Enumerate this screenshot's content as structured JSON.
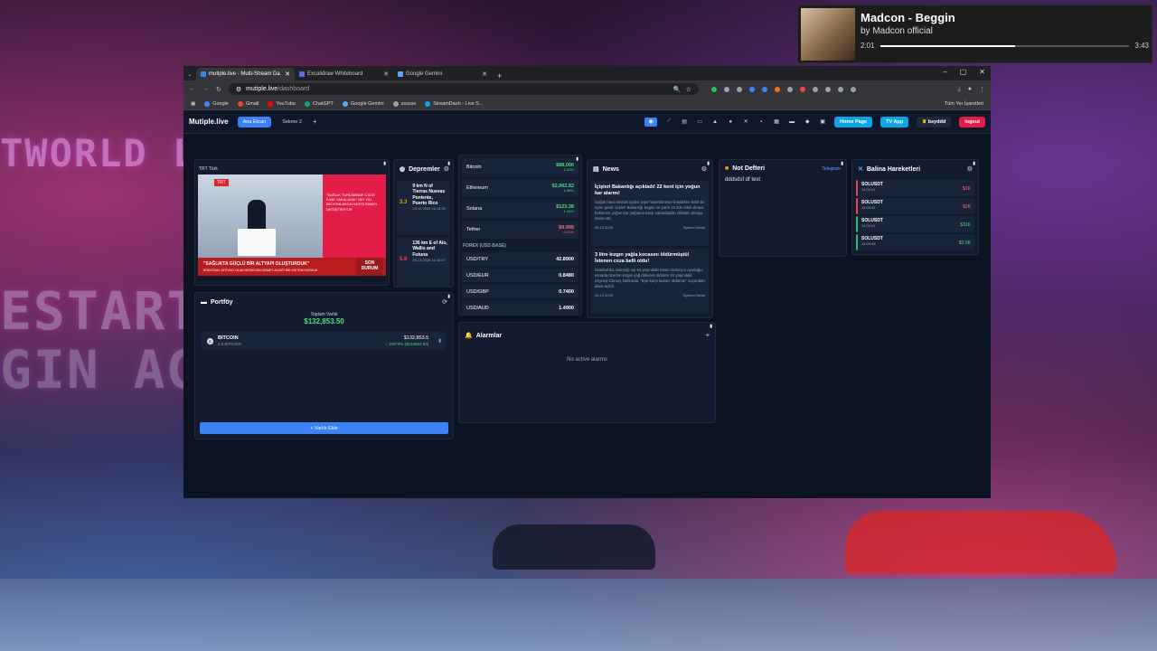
{
  "media": {
    "title": "Madcon - Beggin",
    "artist": "by Madcon official",
    "elapsed": "2:01",
    "duration": "3:43",
    "progress": 0.542
  },
  "browser": {
    "tabs": [
      {
        "title": "mutiple.live - Multi-Stream Da",
        "color": "#3b82f6",
        "active": true
      },
      {
        "title": "Excalidraw Whiteboard",
        "color": "#6366f1",
        "active": false
      },
      {
        "title": "Google Gemini",
        "color": "#60a5fa",
        "active": false
      }
    ],
    "url_host": "mutiple.live",
    "url_path": "/dashboard",
    "bookmarks": [
      "Google",
      "Gmail",
      "YouTube",
      "ChatGPT",
      "Google Gemini",
      "ssssss",
      "StreamDash - Live S..."
    ],
    "all_bookmarks": "Tüm Yer İşaretleri"
  },
  "app": {
    "logo": "Mutiple.live",
    "tabs": [
      "Ana Ekran",
      "Sekme 2"
    ],
    "home_page": "Home Page",
    "tv_app": "TV App",
    "user": "bsyddd",
    "logout": "logout"
  },
  "tv": {
    "channel": "TRT Türk",
    "brand": "TRT",
    "panel_text": "\"SAĞLIK TURİZMİNDE CİDDİ İVME YAKALADIK\" NİH YILI MİLYONLARCA HASTA BİNAYI DEĞİŞTİRİYOR",
    "headline": "\"SAĞLIKTA GÜÇLÜ BİR ALTYAPI OLUŞTURDUK\"",
    "subline": "ERDOĞAN: İHTİYACI OLAN HERKESİN HİZMET ALDIĞI BİR SİSTEM KURDUK",
    "son": "SON DURUM"
  },
  "portfolio": {
    "title": "Portföy",
    "total_label": "Toplam Varlık",
    "total": "$132,853.50",
    "assets": [
      {
        "name": "BITCOIN",
        "amount": "1.5 BITCOIN",
        "value": "$132,853.5",
        "change": "↑ 10073% ($132653.50)"
      }
    ],
    "add": "+ Varlık Ekle"
  },
  "quakes": {
    "title": "Depremler",
    "items": [
      {
        "mag": "3.3",
        "place": "9 km N of Tierras Nuevas Poniente, Puerto Rico",
        "time": "28.12.2025 12:14:00"
      },
      {
        "mag": "5.8",
        "place": "136 km E of Alo, Wallis and Futuna",
        "time": "28.12.2025 11:30:07"
      }
    ]
  },
  "markets": {
    "crypto": [
      {
        "name": "Bitcoin",
        "price": "$88,000",
        "change": "1.53%",
        "dir": "up"
      },
      {
        "name": "Ethereum",
        "price": "$2,962.82",
        "change": "1.88%",
        "dir": "up"
      },
      {
        "name": "Solana",
        "price": "$123.38",
        "change": "1.44%",
        "dir": "up"
      },
      {
        "name": "Tether",
        "price": "$0.999",
        "change": "-0.01%",
        "dir": "down"
      }
    ],
    "forex_title": "FOREX (USD BASE)",
    "forex": [
      {
        "pair": "USD/TRY",
        "rate": "42.8900"
      },
      {
        "pair": "USD/EUR",
        "rate": "0.8480"
      },
      {
        "pair": "USD/GBP",
        "rate": "0.7400"
      },
      {
        "pair": "USD/AUD",
        "rate": "1.4900"
      }
    ]
  },
  "news": {
    "title": "News",
    "items": [
      {
        "headline": "İçişleri Bakanlığı açıkladı! 22 kent için yoğun kar alarmı!",
        "body": "Soğuk hava etkisini iyiden iyiye hissettirmeye başlarken kritik bir uyarı geldi. İçişleri Bakanlığı bugün ve yarın 22 ilde etkili olması beklenen yoğun kar yağışına karşı vatandaşları dikkatli olmaya davet etti.",
        "date": "28.12.2025",
        "source": "System News"
      },
      {
        "headline": "3 litre kızgın yağla kocasını öldürmüştü! İstenen ceza belli oldu!",
        "body": "İstanbul'da, tartıştığı eşi 53 yaşındaki Sinan Gürsoy'u uyuduğu esnada üzerine kızgın yağ dökerek öldüren 44 yaşındaki Zeynep Gürsoy hakkında, \"Eşe karşı kasten öldürme\" suçundan dava açıldı.",
        "date": "28.12.2025",
        "source": "System News"
      }
    ]
  },
  "alarms": {
    "title": "Alarmlar",
    "empty": "No active alarms"
  },
  "notes": {
    "title": "Not Defteri",
    "telegram": "Telegram",
    "text": "dddsdsf df test"
  },
  "whale": {
    "title": "Balina Hareketleri",
    "items": [
      {
        "pair": "SOLUSDT",
        "time": "14:09:41",
        "amount": "$1K",
        "side": "sell"
      },
      {
        "pair": "SOLUSDT",
        "time": "14:09:41",
        "amount": "$2K",
        "side": "sell"
      },
      {
        "pair": "SOLUSDT",
        "time": "14:09:41",
        "amount": "$31K",
        "side": "buy"
      },
      {
        "pair": "SOLUSDT",
        "time": "14:09:48",
        "amount": "$2.9K",
        "side": "buy"
      }
    ]
  }
}
